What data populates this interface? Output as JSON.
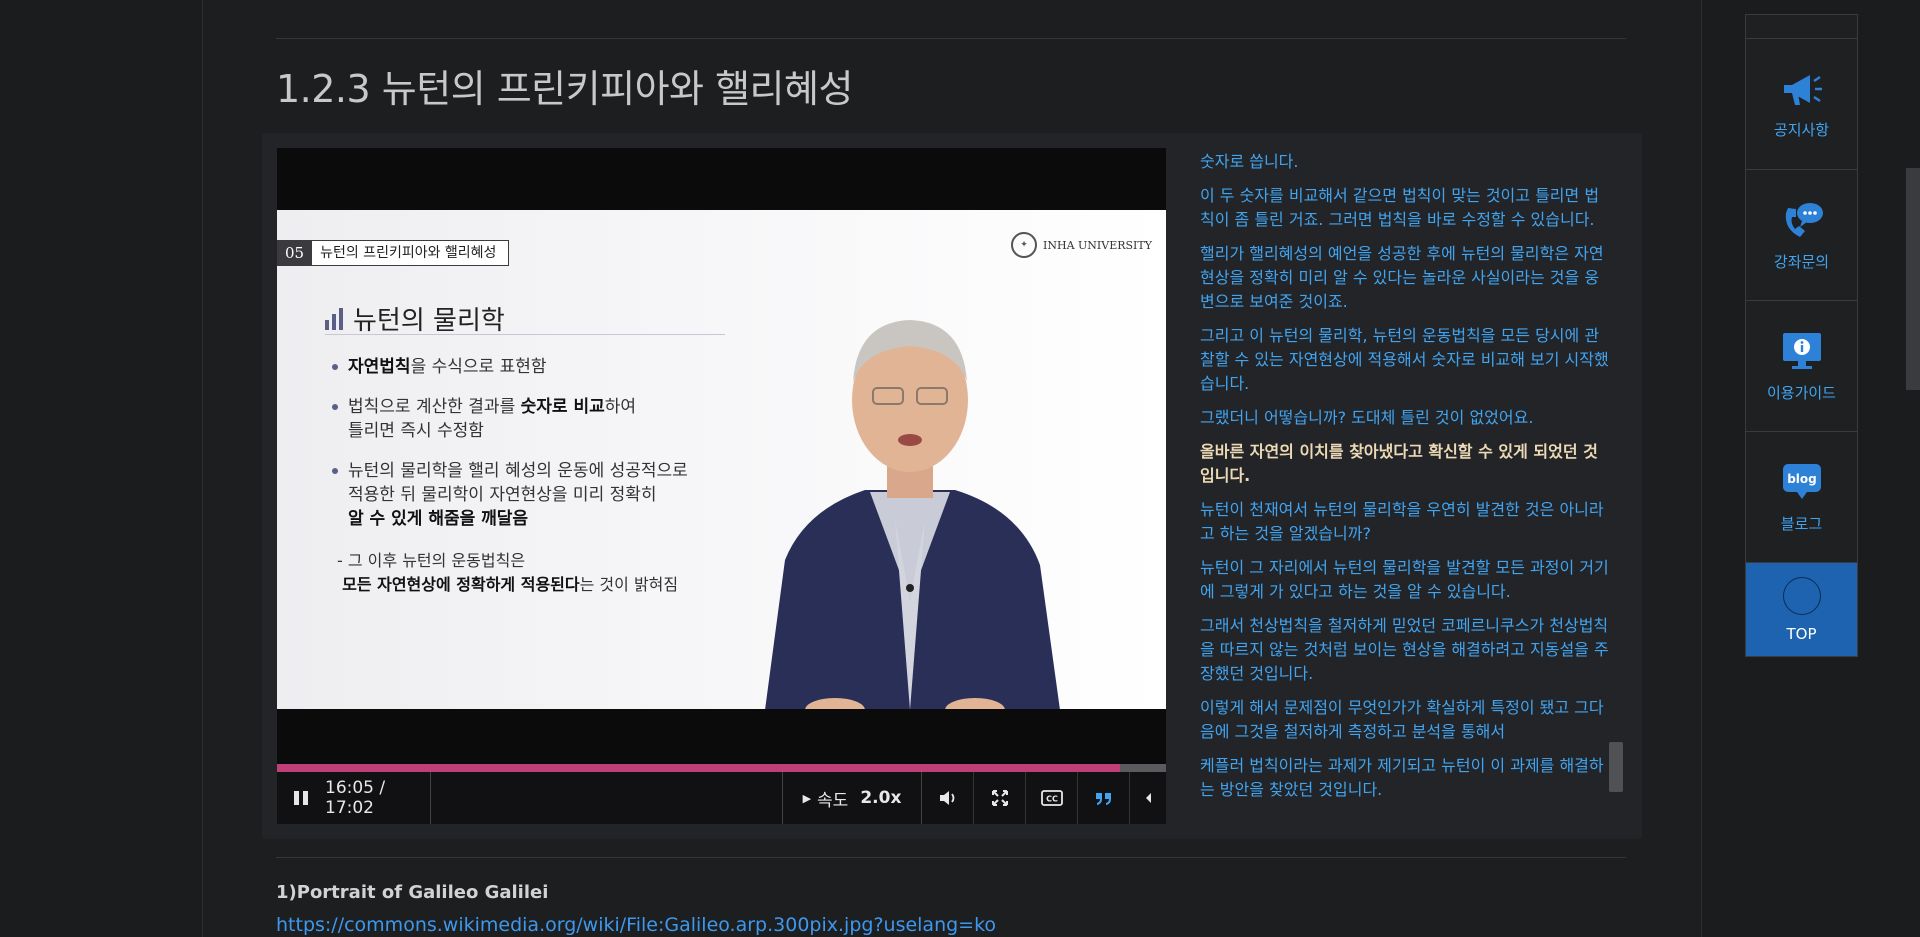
{
  "section_title": "1.2.3 뉴턴의 프린키피아와 핼리혜성",
  "slide": {
    "number": "05",
    "tag_title": "뉴턴의 프린키피아와 핼리혜성",
    "logo_text": "INHA UNIVERSITY",
    "heading": "뉴턴의 물리학",
    "bullet1_bold": "자연법칙",
    "bullet1_rest": "을 수식으로 표현함",
    "bullet2_pre": "법칙으로 계산한 결과를 ",
    "bullet2_bold": "숫자로 비교",
    "bullet2_post": "하여",
    "bullet2_line2": "틀리면 즉시 수정함",
    "bullet3_line1": "뉴턴의 물리학을 핼리 혜성의 운동에 성공적으로",
    "bullet3_line2": "적용한 뒤 물리학이 자연현상을 미리 정확히",
    "bullet3_bold": "알 수 있게 해줌을 깨달음",
    "sub_line1": "- 그 이후 뉴턴의 운동법칙은",
    "sub_bold": "모든 자연현상에 정확하게 적용된다",
    "sub_post": "는 것이 밝혀짐"
  },
  "player": {
    "time": "16:05 / 17:02",
    "progress_fraction": 0.948,
    "speed_label": "속도",
    "speed_value": "2.0x",
    "icons": [
      "pause-icon",
      "volume-icon",
      "fullscreen-icon",
      "cc-icon",
      "quote-icon",
      "collapse-icon"
    ]
  },
  "transcript": [
    "숫자로 씁니다.",
    "이 두 숫자를 비교해서 같으면 법칙이 맞는 것이고 틀리면 법칙이 좀 틀린 거죠. 그러면 법칙을 바로 수정할 수 있습니다.",
    "핼리가 핼리혜성의 예언을 성공한 후에 뉴턴의 물리학은 자연현상을 정확히 미리 알 수 있다는 놀라운 사실이라는 것을 웅변으로 보여준 것이죠.",
    "그리고 이 뉴턴의 물리학, 뉴턴의 운동법칙을 모든 당시에 관찰할 수 있는 자연현상에 적용해서 숫자로 비교해 보기 시작했습니다.",
    "그랬더니 어떻습니까? 도대체 틀린 것이 없었어요.",
    "올바른 자연의 이치를 찾아냈다고 확신할 수 있게 되었던 것입니다.",
    "뉴턴이 천재여서 뉴턴의 물리학을 우연히 발견한 것은 아니라고 하는 것을 알겠습니까?",
    "뉴턴이 그 자리에서 뉴턴의 물리학을 발견할 모든 과정이 거기에 그렇게 가 있다고 하는 것을 알 수 있습니다.",
    "그래서 천상법칙을 철저하게 믿었던 코페르니쿠스가 천상법칙을 따르지 않는 것처럼 보이는 현상을 해결하려고 지동설을 주장했던 것입니다.",
    "이렇게 해서 문제점이 무엇인가가 확실하게 특정이 됐고 그다음에 그것을 철저하게 측정하고 분석을 통해서",
    "케플러 법칙이라는 과제가 제기되고 뉴턴이 이 과제를 해결하는 방안을 찾았던 것입니다."
  ],
  "transcript_current_index": 5,
  "reference": {
    "title": "1)Portrait of Galileo Galilei",
    "link": "https://commons.wikimedia.org/wiki/File:Galileo.arp.300pix.jpg?uselang=ko"
  },
  "side_nav": {
    "items": [
      {
        "label": "공지사항",
        "icon": "megaphone-icon"
      },
      {
        "label": "강좌문의",
        "icon": "phone-chat-icon"
      },
      {
        "label": "이용가이드",
        "icon": "monitor-info-icon"
      },
      {
        "label": "블로그",
        "icon": "blog-icon"
      }
    ],
    "top_label": "TOP",
    "blog_icon_text": "blog"
  },
  "colors": {
    "accent_blue": "#41a4f0",
    "progress": "#c03f76",
    "top_button": "#1d63b0",
    "current_line": "#ecd9b5"
  }
}
